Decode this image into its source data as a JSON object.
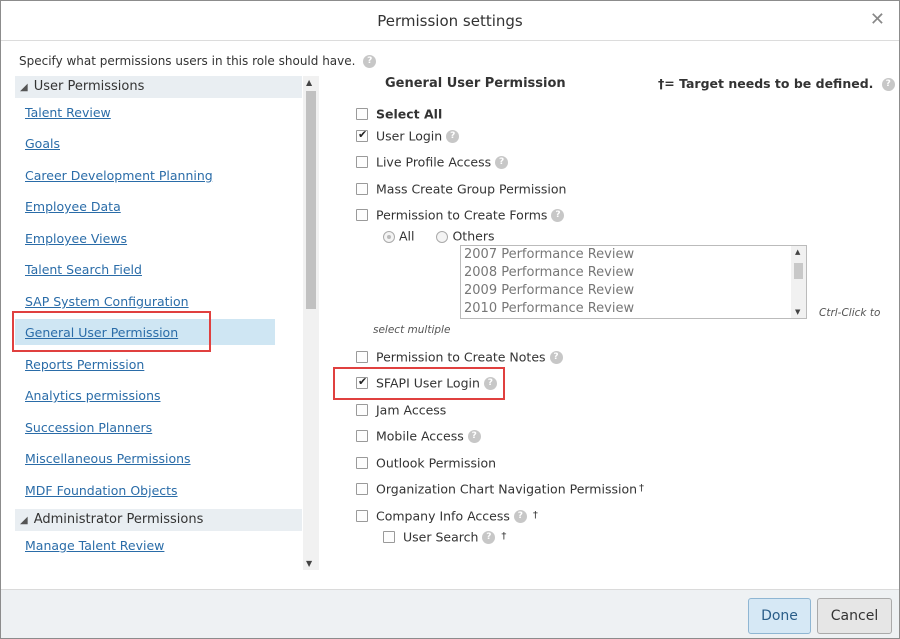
{
  "dialog": {
    "title": "Permission settings",
    "close_glyph": "✕",
    "intro": "Specify what permissions users in this role should have.",
    "help_glyph": "?"
  },
  "sidebar": {
    "section_user": "User Permissions",
    "section_admin": "Administrator Permissions",
    "triangle_glyph": "◢",
    "user_items": [
      {
        "label": "Talent Review"
      },
      {
        "label": "Goals"
      },
      {
        "label": "Career Development Planning"
      },
      {
        "label": "Employee Data"
      },
      {
        "label": "Employee Views"
      },
      {
        "label": "Talent Search Field"
      },
      {
        "label": "SAP System Configuration"
      },
      {
        "label": "General User Permission",
        "selected": true
      },
      {
        "label": "Reports Permission"
      },
      {
        "label": "Analytics permissions"
      },
      {
        "label": "Succession Planners"
      },
      {
        "label": "Miscellaneous Permissions"
      },
      {
        "label": "MDF Foundation Objects"
      }
    ],
    "admin_items": [
      {
        "label": "Manage Talent Review"
      }
    ]
  },
  "panel": {
    "title": "General User Permission",
    "target_note": "†= Target needs to be defined.",
    "permissions": [
      {
        "label": "Select All",
        "checked": false
      },
      {
        "label": "User Login",
        "checked": true
      },
      {
        "label": "Live Profile Access",
        "checked": false
      },
      {
        "label": "Mass Create Group Permission",
        "checked": false
      },
      {
        "label": "Permission to Create Forms",
        "checked": false
      },
      {
        "label": "Permission to Create Notes",
        "checked": false
      },
      {
        "label": "SFAPI User Login",
        "checked": true
      },
      {
        "label": "Jam Access",
        "checked": false
      },
      {
        "label": "Mobile Access",
        "checked": false
      },
      {
        "label": "Outlook Permission",
        "checked": false
      },
      {
        "label": "Organization Chart Navigation Permission",
        "checked": false
      },
      {
        "label": "Company Info Access",
        "checked": false
      },
      {
        "label": "User Search",
        "checked": false
      }
    ],
    "dagger": "†",
    "forms_scope": {
      "all_label": "All",
      "others_label": "Others",
      "selected": "All"
    },
    "forms_list": [
      "2007 Performance Review",
      "2008 Performance Review",
      "2009 Performance Review",
      "2010 Performance Review"
    ],
    "hint_ctrl": "Ctrl-Click to",
    "hint_multi": "select multiple"
  },
  "footer": {
    "done_label": "Done",
    "cancel_label": "Cancel"
  },
  "colors": {
    "link": "#2a6ca8",
    "highlight": "#e0403f",
    "selected_bg": "#cfe6f3"
  }
}
